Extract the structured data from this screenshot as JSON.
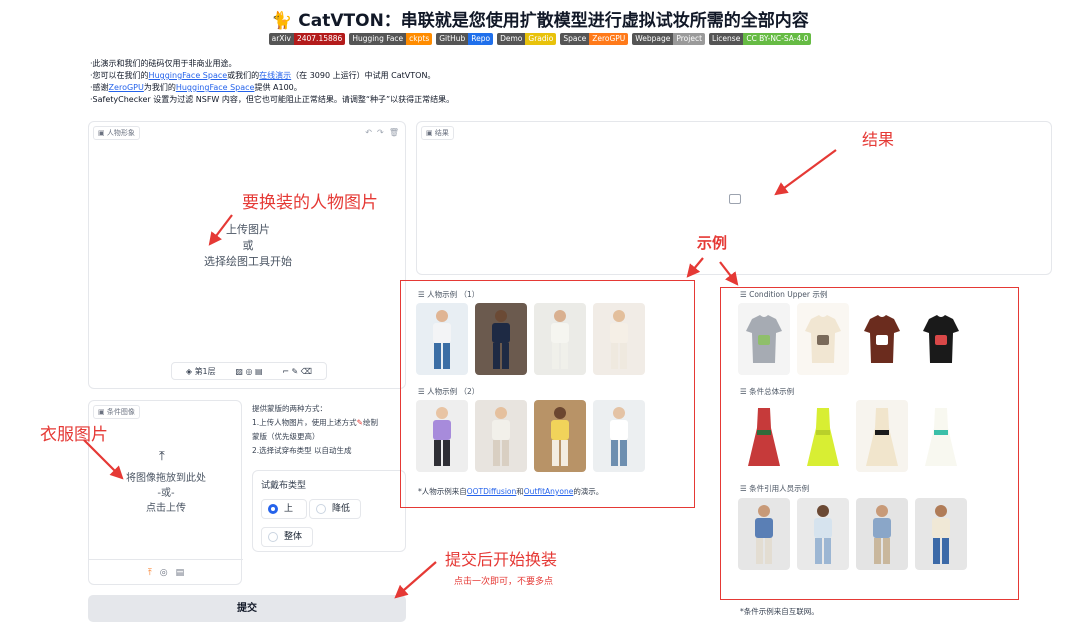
{
  "header": {
    "title": "🐈 CatVTON：串联就是您使用扩散模型进行虚拟试妆所需的全部内容",
    "badges": [
      {
        "label": "arXiv",
        "value": "2407.15886",
        "color": "#b31b1b"
      },
      {
        "label": "Hugging Face",
        "value": "ckpts",
        "color": "#ff8c00"
      },
      {
        "label": "GitHub",
        "value": "Repo",
        "color": "#1f6feb"
      },
      {
        "label": "Demo",
        "value": "Gradio",
        "color": "#e8c20b"
      },
      {
        "label": "Space",
        "value": "ZeroGPU",
        "color": "#ff7a1a"
      },
      {
        "label": "Webpage",
        "value": "Project",
        "color": "#9a9a9a"
      },
      {
        "label": "License",
        "value": "CC BY-NC-SA-4.0",
        "color": "#66bb44"
      }
    ]
  },
  "notes": {
    "line1": "·此演示和我们的砝码仅用于非商业用途。",
    "line2_a": "·您可以在我们的",
    "line2_link1": "HuggingFace Space",
    "line2_b": "或我们的",
    "line2_link2": "在线演示",
    "line2_c": "（在 3090 上运行）中试用 CatVTON。",
    "line3_a": "·感谢",
    "line3_link1": "ZeroGPU",
    "line3_b": "为我们的",
    "line3_link2": "HuggingFace Space",
    "line3_c": "提供 A100。",
    "line4": "·SafetyChecker 设置为过滤 NSFW 内容，但它也可能阻止正常结果。请调整“种子”以获得正常结果。"
  },
  "person_panel": {
    "label": "人物形象",
    "upload_line1": "上传图片",
    "upload_line2": "或",
    "upload_line3": "选择绘图工具开始",
    "layer_label": "第1层"
  },
  "result_panel": {
    "label": "结果"
  },
  "cloth_panel": {
    "label": "条件图像",
    "drop_line1": "将图像拖放到此处",
    "drop_line2": "-或-",
    "drop_line3": "点击上传"
  },
  "instructions": {
    "line1": "提供蒙版的两种方式：",
    "line2": "1.上传人物图片，使用上述方式",
    "line2_tail": "绘制",
    "line3": "蒙版（优先级更高）",
    "line4": "2.选择试穿布类型 以自动生成"
  },
  "cloth_type": {
    "title": "试戴布类型",
    "options": [
      "上",
      "降低",
      "整体"
    ],
    "selected": "上"
  },
  "submit": {
    "label": "提交"
  },
  "person_examples": {
    "group1_label": "人物示例 （1）",
    "group2_label": "人物示例 （2）",
    "credit_a": "*人物示例来自",
    "credit_link1": "OOTDiffusion",
    "credit_b": "和",
    "credit_link2": "OutfitAnyone",
    "credit_c": "的演示。"
  },
  "condition_examples": {
    "upper_label": "Condition Upper 示例",
    "overall_label": "条件总体示例",
    "person_label": "条件引用人员示例",
    "credit": "*条件示例来自互联网。"
  },
  "annotations": {
    "person_image": "要换装的人物图片",
    "result": "结果",
    "examples": "示例",
    "cloth_image": "衣服图片",
    "submit_hint": "提交后开始换装",
    "submit_sub": "点击一次即可，不要多点"
  },
  "colors": {
    "annotation": "#e53935",
    "link": "#2563eb",
    "radio_selected": "#2563eb"
  }
}
